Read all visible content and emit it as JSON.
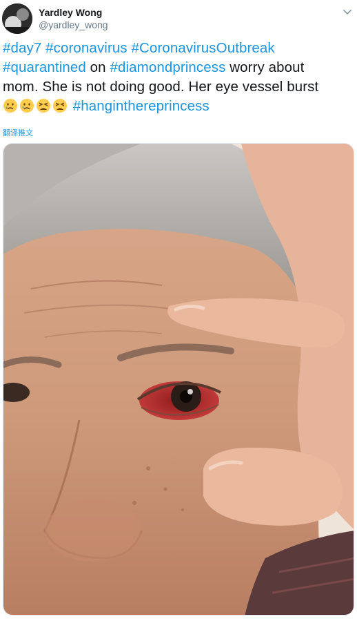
{
  "author": {
    "display_name": "Yardley Wong",
    "handle": "@yardley_wong"
  },
  "tweet": {
    "line1": {
      "tags": [
        "#day7",
        "#coronavirus",
        "#CoronavirusOutbreak"
      ]
    },
    "line2": {
      "tag1": "#quarantined",
      "text1": " on ",
      "tag2": "#diamondprincess",
      "text2": " worry about"
    },
    "line3": {
      "text": "mom. She is not doing good. Her eye vessel burst"
    },
    "line4": {
      "emojis": [
        "crying-face",
        "crying-face",
        "tired-face",
        "tired-face"
      ],
      "tag": "#hanginthereprincess"
    }
  },
  "translate_label": "翻译推文",
  "colors": {
    "link": "#1b95e0",
    "text": "#14171a",
    "secondary": "#657786"
  },
  "media": {
    "icon": "photo"
  }
}
